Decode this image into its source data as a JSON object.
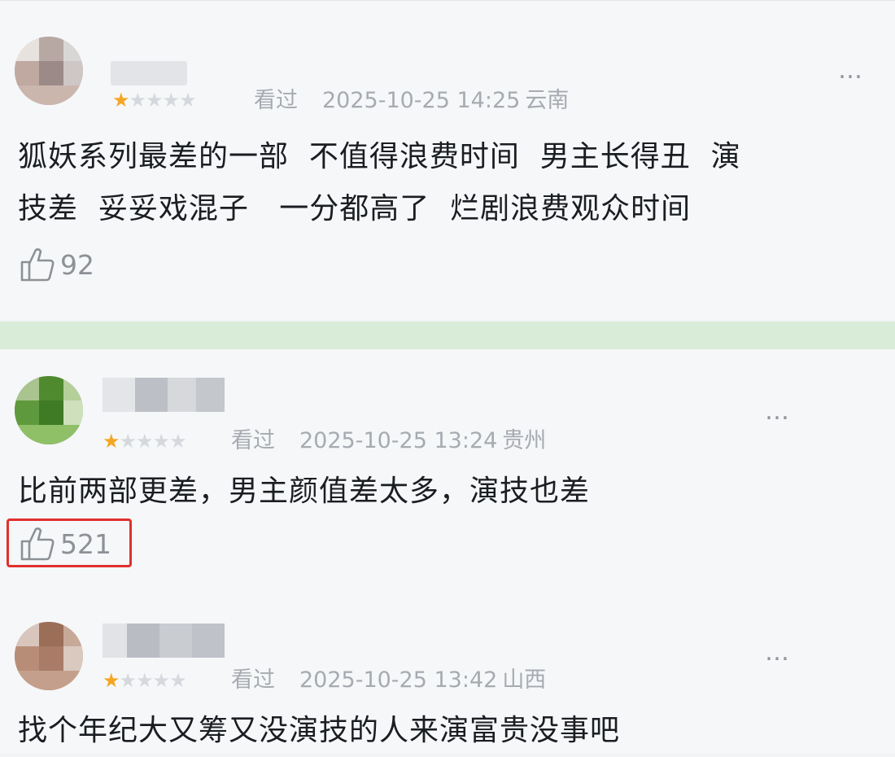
{
  "comments": [
    {
      "rating_stars": 1,
      "seen_label": "看过",
      "datetime": "2025-10-25 14:25",
      "location": "云南",
      "text_lines": [
        "狐妖系列最差的一部  不值得浪费时间  男主长得丑  演",
        "技差  妥妥戏混子   一分都高了  烂剧浪费观众时间"
      ],
      "likes": "92",
      "more_icon": "…"
    },
    {
      "rating_stars": 1,
      "seen_label": "看过",
      "datetime": "2025-10-25 13:24",
      "location": "贵州",
      "text_lines": [
        "比前两部更差，男主颜值差太多，演技也差"
      ],
      "likes": "521",
      "highlighted": true,
      "more_icon": "…"
    },
    {
      "rating_stars": 1,
      "seen_label": "看过",
      "datetime": "2025-10-25 13:42",
      "location": "山西",
      "text_lines": [
        "找个年纪大又筹又没演技的人来演富贵没事吧"
      ],
      "more_icon": "…"
    }
  ],
  "star_glyphs": {
    "on": "★",
    "off": "★★★★"
  },
  "colors": {
    "star": "#f5a623",
    "highlight_border": "#e0302c",
    "divider": "#d9ecd7"
  }
}
